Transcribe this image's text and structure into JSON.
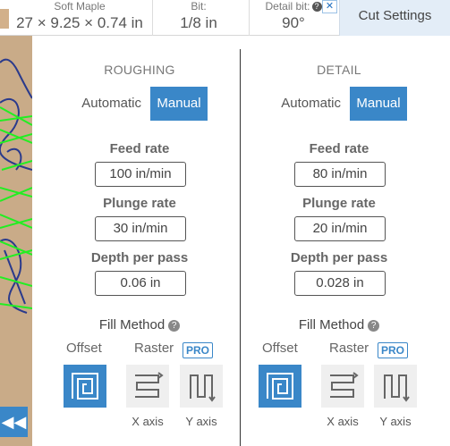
{
  "topbar": {
    "material_label": "Soft Maple",
    "material_size": "27 × 9.25 × 0.74 in",
    "bit_label": "Bit:",
    "bit_value": "1/8 in",
    "detail_bit_label": "Detail bit:",
    "detail_bit_help": "?",
    "detail_bit_value": "90°",
    "ad_close": "✕",
    "cut_settings": "Cut Settings"
  },
  "collapse_button": "◀◀",
  "roughing": {
    "title": "ROUGHING",
    "mode_automatic": "Automatic",
    "mode_manual": "Manual",
    "feed_rate_label": "Feed rate",
    "feed_rate_value": "100 in/min",
    "plunge_rate_label": "Plunge rate",
    "plunge_rate_value": "30 in/min",
    "depth_label": "Depth per pass",
    "depth_value": "0.06 in",
    "fill_method_label": "Fill Method",
    "fill_help": "?",
    "offset_label": "Offset",
    "raster_label": "Raster",
    "pro_badge": "PRO",
    "x_axis_label": "X axis",
    "y_axis_label": "Y axis"
  },
  "detail": {
    "title": "DETAIL",
    "mode_automatic": "Automatic",
    "mode_manual": "Manual",
    "feed_rate_label": "Feed rate",
    "feed_rate_value": "80 in/min",
    "plunge_rate_label": "Plunge rate",
    "plunge_rate_value": "20 in/min",
    "depth_label": "Depth per pass",
    "depth_value": "0.028 in",
    "fill_method_label": "Fill Method",
    "fill_help": "?",
    "offset_label": "Offset",
    "raster_label": "Raster",
    "pro_badge": "PRO",
    "x_axis_label": "X axis",
    "y_axis_label": "Y axis"
  },
  "colors": {
    "accent": "#3a87c8",
    "wood": "#c9ab88",
    "toolpath": "#22ee22"
  }
}
